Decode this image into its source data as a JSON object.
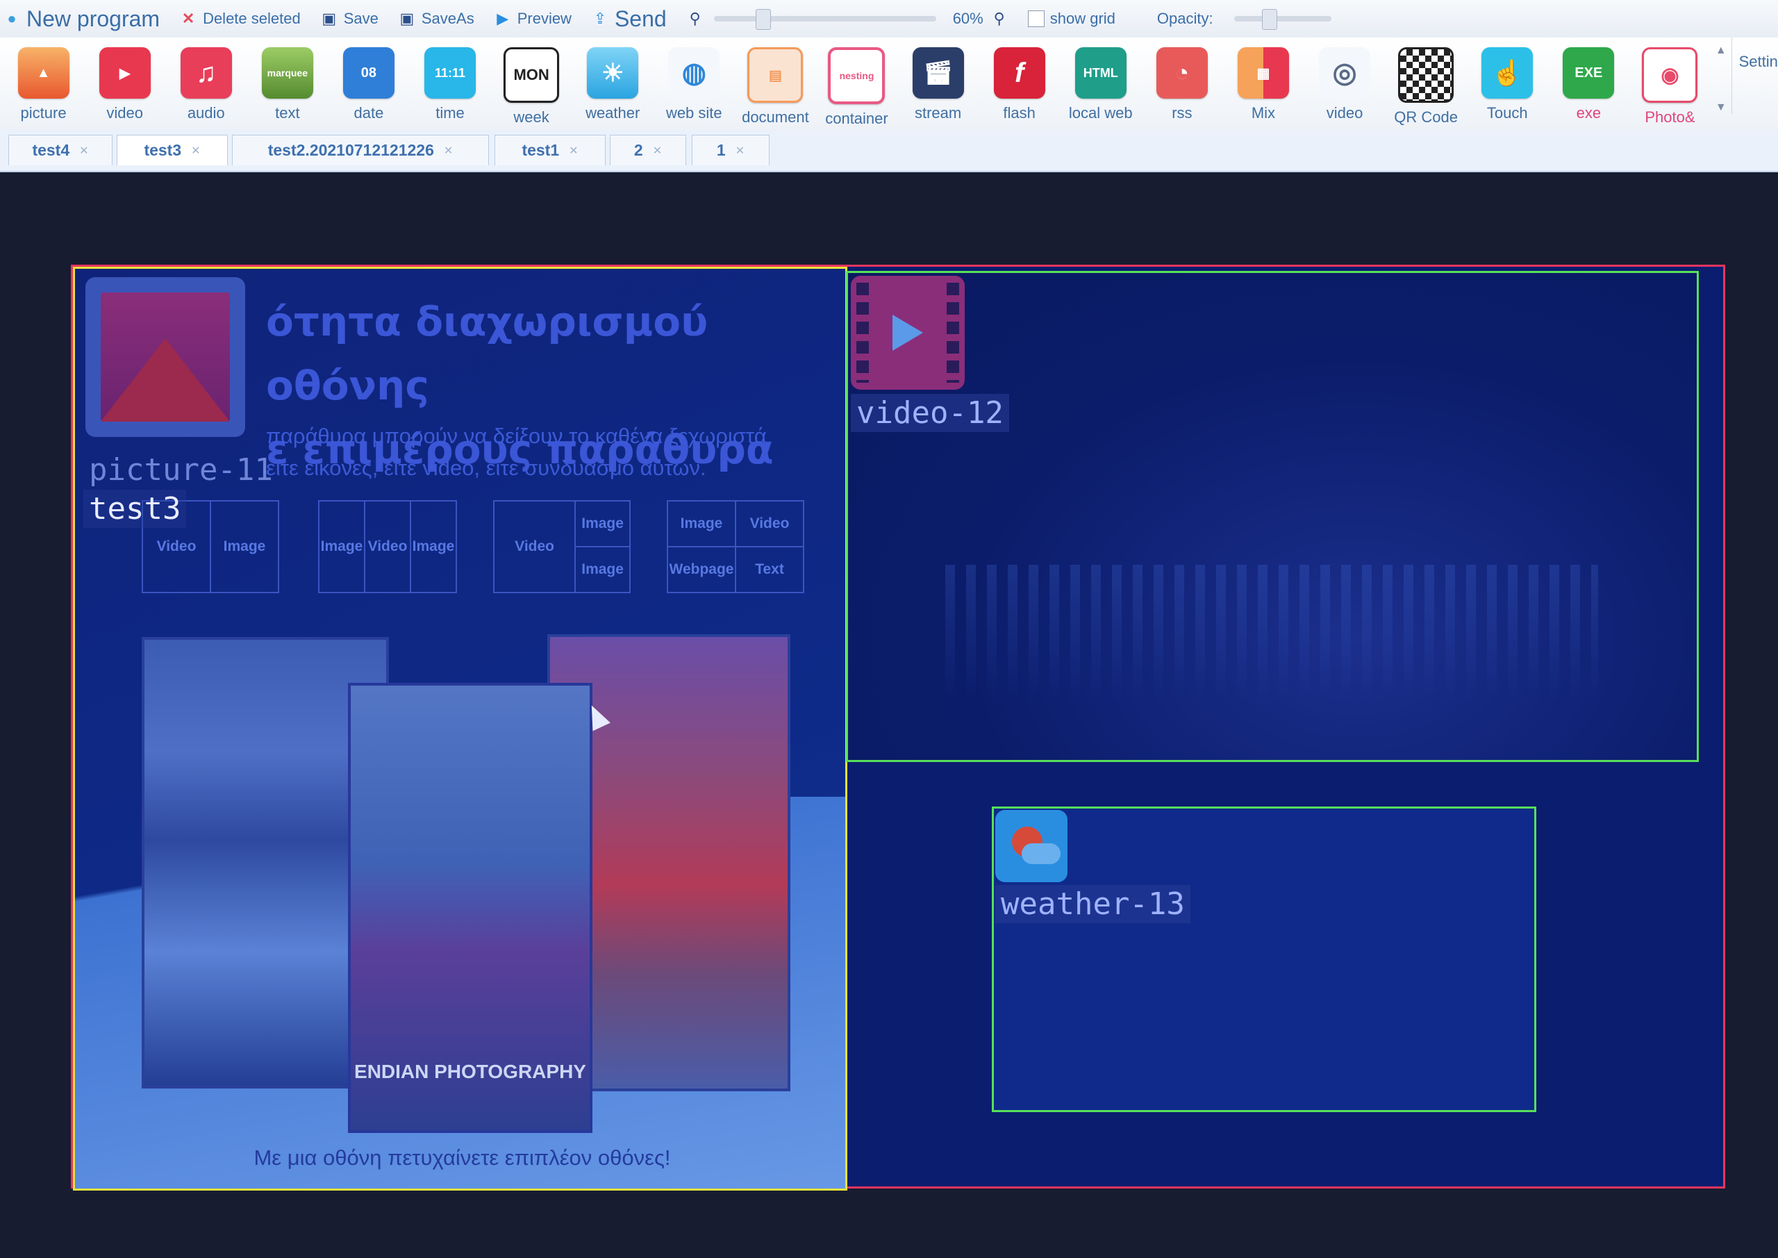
{
  "toolbar": {
    "new_program": "New program",
    "delete_selected": "Delete seleted",
    "save": "Save",
    "saveas": "SaveAs",
    "preview": "Preview",
    "send": "Send",
    "zoom_level": "60%",
    "show_grid": "show grid",
    "opacity": "Opacity:"
  },
  "ribbon": [
    {
      "label": "picture",
      "icon": "picture-icon",
      "color": "#f08a3c"
    },
    {
      "label": "video",
      "icon": "video-icon",
      "color": "#e8384f"
    },
    {
      "label": "audio",
      "icon": "audio-icon",
      "color": "#e83e5a"
    },
    {
      "label": "text",
      "icon": "text-marquee-icon",
      "color": "#7cb342"
    },
    {
      "label": "date",
      "icon": "date-icon",
      "color": "#2f7fd8"
    },
    {
      "label": "time",
      "icon": "time-icon",
      "color": "#29b6e8"
    },
    {
      "label": "week",
      "icon": "week-icon",
      "color": "#333333"
    },
    {
      "label": "weather",
      "icon": "weather-icon",
      "color": "#35aee8"
    },
    {
      "label": "web site",
      "icon": "website-globe-icon",
      "color": "#2f87d8"
    },
    {
      "label": "document",
      "icon": "document-icon",
      "color": "#f49a5a"
    },
    {
      "label": "container",
      "icon": "container-icon",
      "color": "#e85a84"
    },
    {
      "label": "stream",
      "icon": "stream-clapper-icon",
      "color": "#2b3e6a"
    },
    {
      "label": "flash",
      "icon": "flash-icon",
      "color": "#d8233a"
    },
    {
      "label": "local web",
      "icon": "local-web-html-icon",
      "color": "#1f9e8a"
    },
    {
      "label": "rss",
      "icon": "rss-icon",
      "color": "#e85a5a"
    },
    {
      "label": "Mix",
      "icon": "mix-icon",
      "color": "#e86a4a"
    },
    {
      "label": "video",
      "icon": "video-camera-icon",
      "color": "#5a6a86"
    },
    {
      "label": "QR Code",
      "icon": "qr-code-icon",
      "color": "#333333"
    },
    {
      "label": "Touch",
      "icon": "touch-icon",
      "color": "#2cc0e8"
    },
    {
      "label": "exe",
      "icon": "exe-icon",
      "color": "#2ea84a"
    },
    {
      "label": "Photo&",
      "icon": "photo-camera-icon",
      "color": "#e84a6a"
    }
  ],
  "ribbon_settings": "Settin",
  "tabs": [
    {
      "label": "test4"
    },
    {
      "label": "test3"
    },
    {
      "label": "test2.20210712121226"
    },
    {
      "label": "test1"
    },
    {
      "label": "2"
    },
    {
      "label": "1"
    }
  ],
  "canvas": {
    "picture": {
      "label": "picture-11",
      "program_name": "test3",
      "headline_1": "ότητα διαχωρισμού οθόνης",
      "headline_2": "ε επιμέρους παράθυρα",
      "subline_1": "παράθυρα μπορούν να δείξουν το καθένα ξεχωριστά",
      "subline_2": "είτε εικόνες, είτε video, είτε συνδυασμό αυτών.",
      "layouts": [
        [
          "Video",
          "Image"
        ],
        [
          "Image",
          "Video",
          "Image"
        ],
        [
          "Video",
          "Image",
          "Image"
        ],
        [
          "Image",
          "Video",
          "Webpage",
          "Text"
        ]
      ],
      "photo_caption": "ENDIAN PHOTOGRAPHY",
      "footer": "Με μια οθόνη πετυχαίνετε επιπλέον οθόνες!"
    },
    "video": {
      "label": "video-12"
    },
    "weather": {
      "label": "weather-13"
    }
  }
}
